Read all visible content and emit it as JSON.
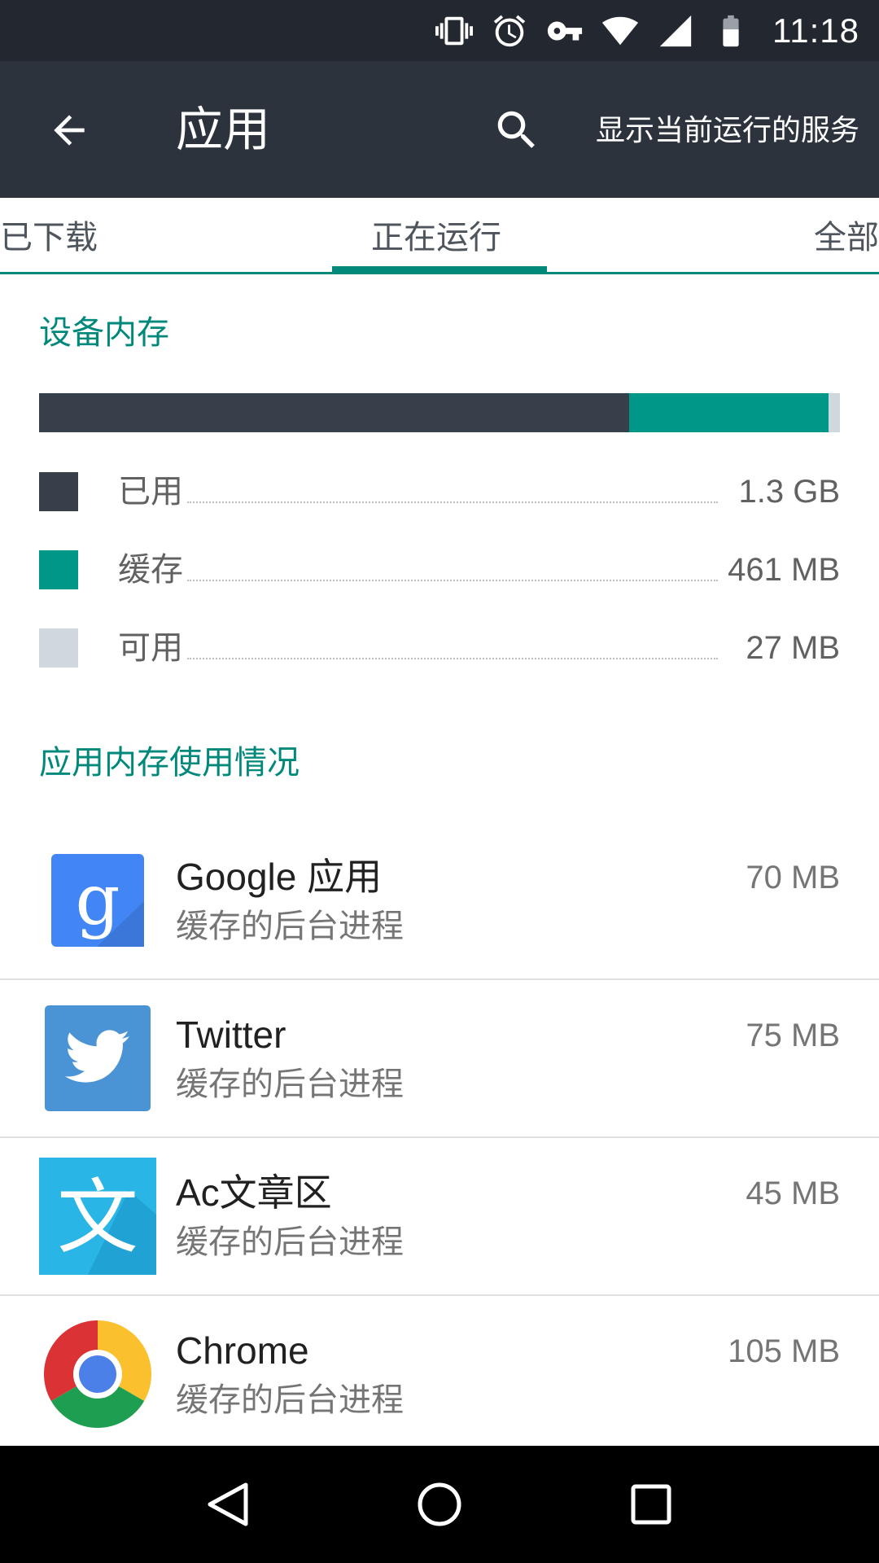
{
  "status_bar": {
    "time": "11:18",
    "icons": [
      "vibrate-icon",
      "alarm-icon",
      "vpn-key-icon",
      "wifi-icon",
      "signal-icon",
      "battery-icon"
    ]
  },
  "toolbar": {
    "title": "应用",
    "back_icon": "arrow-back-icon",
    "search_icon": "search-icon",
    "action_label": "显示当前运行的服务"
  },
  "tabs": {
    "items": [
      {
        "label": "已下载"
      },
      {
        "label": "正在运行",
        "selected": true
      },
      {
        "label": "全部"
      }
    ]
  },
  "device_memory": {
    "title": "设备内存",
    "used_fraction": 0.737,
    "cached_fraction": 0.249,
    "free_fraction": 0.014,
    "legend": [
      {
        "label": "已用",
        "value": "1.3 GB",
        "color": "#37404a"
      },
      {
        "label": "缓存",
        "value": "461 MB",
        "color": "#009688"
      },
      {
        "label": "可用",
        "value": "27 MB",
        "color": "#cfd8dc"
      }
    ]
  },
  "app_memory": {
    "title": "应用内存使用情况",
    "apps": [
      {
        "name": "Google 应用",
        "status": "缓存的后台进程",
        "size": "70 MB",
        "icon": "google-app-icon"
      },
      {
        "name": "Twitter",
        "status": "缓存的后台进程",
        "size": "75 MB",
        "icon": "twitter-icon"
      },
      {
        "name": "Ac文章区",
        "status": "缓存的后台进程",
        "size": "45 MB",
        "icon": "ac-article-icon"
      },
      {
        "name": "Chrome",
        "status": "缓存的后台进程",
        "size": "105 MB",
        "icon": "chrome-icon"
      }
    ]
  },
  "nav_bar": {
    "icons": [
      "back-nav-icon",
      "home-nav-icon",
      "recents-nav-icon"
    ]
  },
  "colors": {
    "accent": "#009688",
    "toolbar": "#2c333c",
    "statusbar": "#232830"
  }
}
